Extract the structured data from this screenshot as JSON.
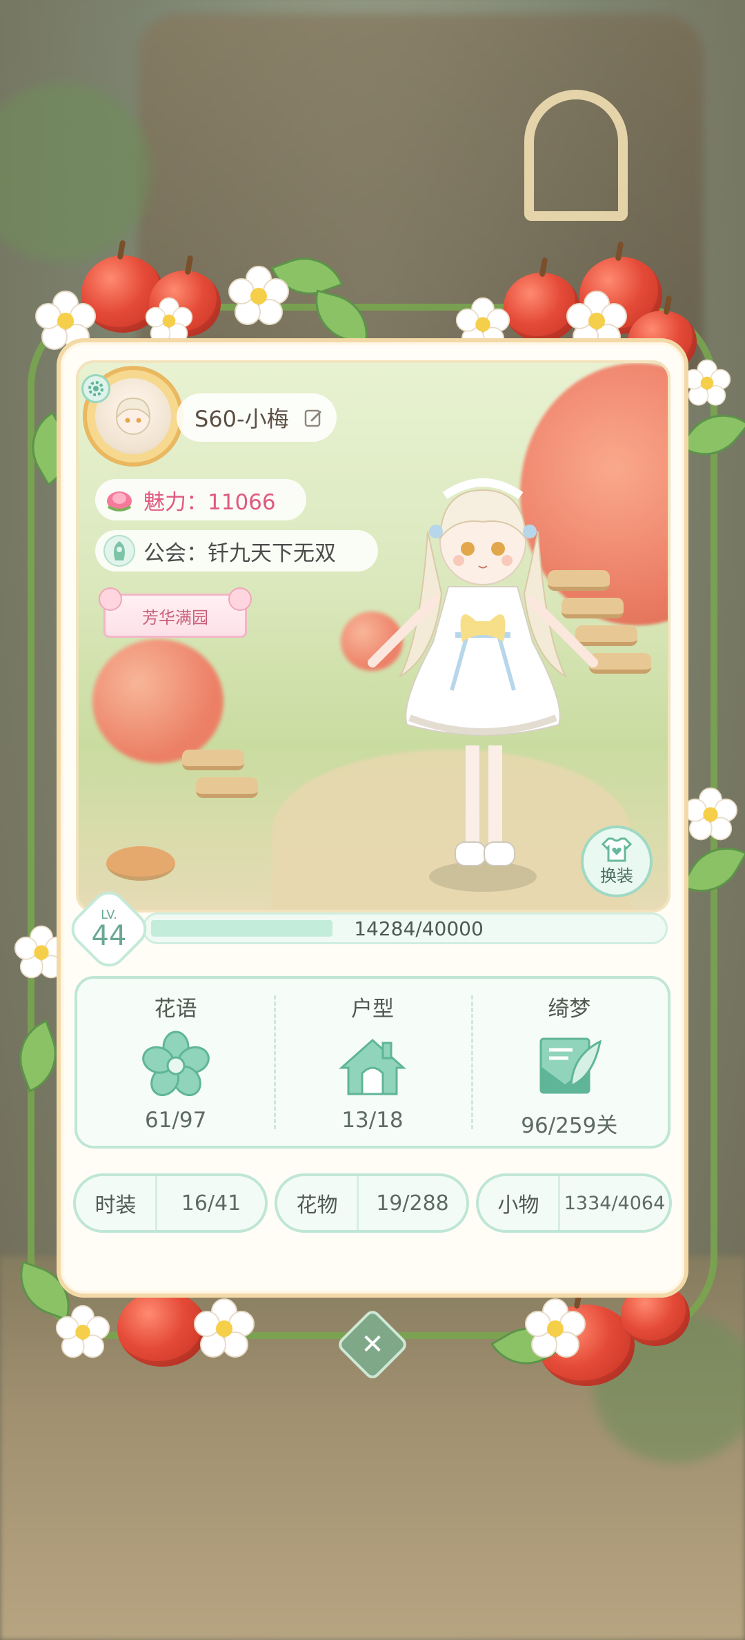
{
  "profile": {
    "name": "S60-小梅",
    "charm_label": "魅力：11066",
    "guild_label": "公会：钎九天下无双",
    "title_badge": "芳华满园",
    "change_outfit": "换装"
  },
  "level": {
    "lv_label": "LV.",
    "lv_value": "44",
    "xp_text": "14284/40000",
    "xp_progress": 0.357
  },
  "stats": [
    {
      "title": "花语",
      "value": "61/97",
      "icon": "flower-icon"
    },
    {
      "title": "户型",
      "value": "13/18",
      "icon": "house-icon"
    },
    {
      "title": "绮梦",
      "value": "96/259关",
      "icon": "letter-quill-icon"
    }
  ],
  "collections": [
    {
      "label": "时装",
      "value": "16/41"
    },
    {
      "label": "花物",
      "value": "19/288"
    },
    {
      "label": "小物",
      "value": "1334/4064"
    }
  ],
  "colors": {
    "accent_mint": "#bfe6d5",
    "charm_pink": "#e0597e",
    "text_dark": "#4f5a52"
  },
  "close_icon": "close-icon"
}
